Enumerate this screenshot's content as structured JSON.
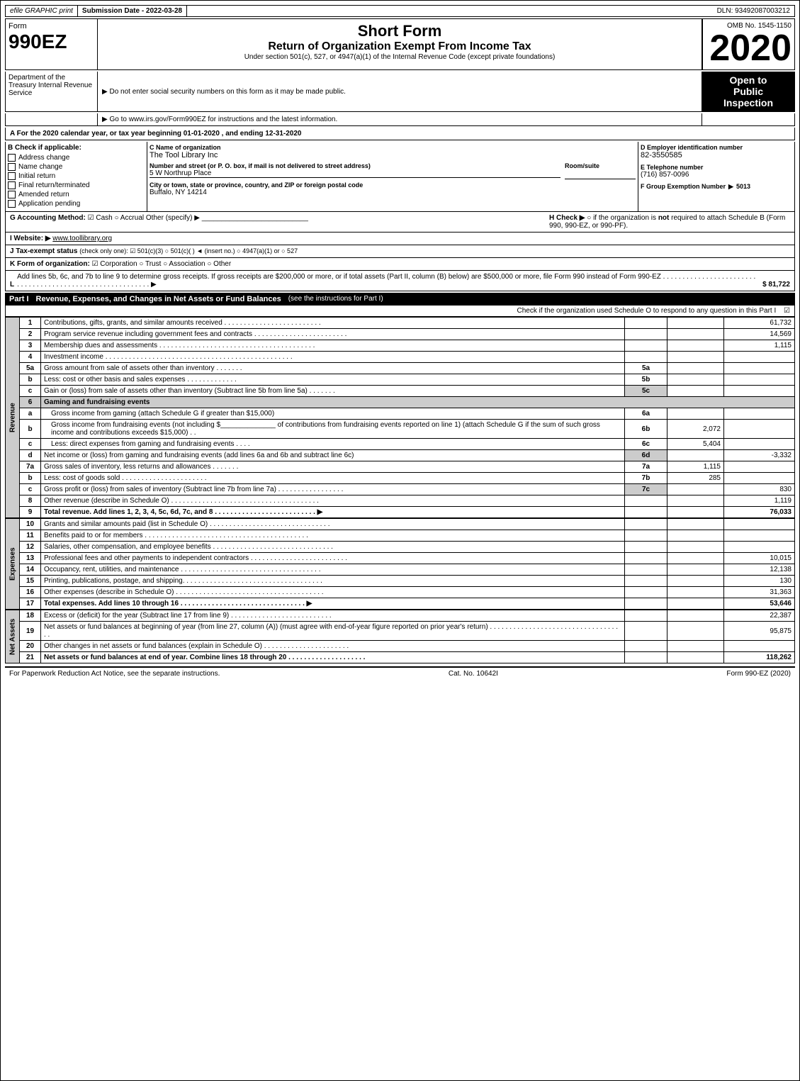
{
  "header": {
    "efile_label": "efile GRAPHIC print",
    "submission_date_label": "Submission Date - 2022-03-28",
    "dln_label": "DLN: 93492087003212",
    "form_number": "Form",
    "form_990ez": "990EZ",
    "form_title": "Short Form",
    "form_subtitle": "Return of Organization Exempt From Income Tax",
    "form_under": "Under section 501(c), 527, or 4947(a)(1) of the Internal Revenue Code (except private foundations)",
    "omb_label": "OMB No. 1545-1150",
    "year": "2020",
    "dept_name": "Department of the Treasury Internal Revenue Service",
    "notice1": "▶ Do not enter social security numbers on this form as it may be made public.",
    "notice2": "▶ Go to www.irs.gov/Form990EZ for instructions and the latest information.",
    "open_label1": "Open to",
    "open_label2": "Public",
    "open_label3": "Inspection"
  },
  "tax_year": {
    "text": "A For the 2020 calendar year, or tax year beginning 01-01-2020 , and ending 12-31-2020"
  },
  "section_b": {
    "label": "B Check if applicable:",
    "items": [
      {
        "label": "Address change",
        "checked": false
      },
      {
        "label": "Name change",
        "checked": false
      },
      {
        "label": "Initial return",
        "checked": false
      },
      {
        "label": "Final return/terminated",
        "checked": false
      },
      {
        "label": "Amended return",
        "checked": false
      },
      {
        "label": "Application pending",
        "checked": false
      }
    ]
  },
  "section_c": {
    "label": "C Name of organization",
    "org_name": "The Tool Library Inc",
    "address_label": "Number and street (or P. O. box, if mail is not delivered to street address)",
    "address": "5 W Northrup Place",
    "room_suite_label": "Room/suite",
    "room_suite": "",
    "city_label": "City or town, state or province, country, and ZIP or foreign postal code",
    "city": "Buffalo, NY  14214"
  },
  "section_d": {
    "label": "D Employer identification number",
    "ein": "82-3550585"
  },
  "section_e": {
    "label": "E Telephone number",
    "phone": "(716) 857-0096"
  },
  "section_f": {
    "label": "F Group Exemption Number",
    "number_label": "Number",
    "arrow": "▶",
    "number": "5013"
  },
  "section_g": {
    "label": "G Accounting Method:",
    "cash": "☑ Cash",
    "accrual": "○ Accrual",
    "other": "Other (specify) ▶"
  },
  "section_h": {
    "label": "H Check ▶",
    "text": "○ if the organization is not required to attach Schedule B (Form 990, 990-EZ, or 990-PF)."
  },
  "section_i": {
    "label": "I Website: ▶",
    "url": "www.toollibrary.org"
  },
  "section_j": {
    "label": "J Tax-exempt status",
    "text": "(check only one): ☑ 501(c)(3) ○ 501(c)( ) ◄ (insert no.) ○ 4947(a)(1) or ○ 527"
  },
  "section_k": {
    "label": "K Form of organization:",
    "items": [
      "☑ Corporation",
      "○ Trust",
      "○ Association",
      "○ Other"
    ]
  },
  "section_l": {
    "label": "L",
    "text": "Add lines 5b, 6c, and 7b to line 9 to determine gross receipts. If gross receipts are $200,000 or more, or if total assets (Part II, column (B) below) are $500,000 or more, file Form 990 instead of Form 990-EZ",
    "dots": ". . . . . . . . . . . . . . . . . . . . . . . . . . . . . . . . . . . . . . . . . . . . . . . . . . . . . . . . . . ▶",
    "amount": "$ 81,722"
  },
  "part1": {
    "label": "Part I",
    "title": "Revenue, Expenses, and Changes in Net Assets or Fund Balances",
    "see_instructions": "(see the instructions for Part I)",
    "schedule_o_text": "Check if the organization used Schedule O to respond to any question in this Part I",
    "rows": [
      {
        "num": "1",
        "desc": "Contributions, gifts, grants, and similar amounts received . . . . . . . . . . . . . . . . . . . . . . . . .",
        "col_num": "",
        "amount": "61,732",
        "shaded": false
      },
      {
        "num": "2",
        "desc": "Program service revenue including government fees and contracts . . . . . . . . . . . . . . . . . . . . . . . .",
        "col_num": "",
        "amount": "14,569",
        "shaded": false
      },
      {
        "num": "3",
        "desc": "Membership dues and assessments . . . . . . . . . . . . . . . . . . . . . . . . . . . . . . . . . . . . . . . .",
        "col_num": "",
        "amount": "1,115",
        "shaded": false
      },
      {
        "num": "4",
        "desc": "Investment income . . . . . . . . . . . . . . . . . . . . . . . . . . . . . . . . . . . . . . . . . . . . . . . .",
        "col_num": "",
        "amount": "",
        "shaded": false
      },
      {
        "num": "5a",
        "desc": "Gross amount from sale of assets other than inventory . . . . . . . .",
        "col_num": "5a",
        "amount": "",
        "shaded": false
      },
      {
        "num": "b",
        "desc": "Less: cost or other basis and sales expenses . . . . . . . . . . . . .",
        "col_num": "5b",
        "amount": "",
        "shaded": false
      },
      {
        "num": "c",
        "desc": "Gain or (loss) from sale of assets other than inventory (Subtract line 5b from line 5a) . . . . . . .",
        "col_num": "",
        "amount": "",
        "shaded": false,
        "right_col": "5c"
      },
      {
        "num": "6",
        "desc": "Gaming and fundraising events",
        "col_num": "",
        "amount": "",
        "shaded": true,
        "header": true
      },
      {
        "num": "a",
        "desc": "Gross income from gaming (attach Schedule G if greater than $15,000)",
        "col_num": "6a",
        "amount": "",
        "shaded": false,
        "indent": true
      },
      {
        "num": "b",
        "desc": "Gross income from fundraising events (not including $______________ of contributions from fundraising events reported on line 1) (attach Schedule G if the sum of such gross income and contributions exceeds $15,000) . .",
        "col_num": "6b",
        "col_val": "2,072",
        "amount": "",
        "shaded": false,
        "indent": true
      },
      {
        "num": "c",
        "desc": "Less: direct expenses from gaming and fundraising events . . . .",
        "col_num": "6c",
        "col_val": "5,404",
        "amount": "",
        "shaded": false,
        "indent": true
      },
      {
        "num": "d",
        "desc": "Net income or (loss) from gaming and fundraising events (add lines 6a and 6b and subtract line 6c)",
        "col_num": "",
        "amount": "-3,332",
        "shaded": false,
        "right_col": "6d"
      },
      {
        "num": "7a",
        "desc": "Gross sales of inventory, less returns and allowances . . . . . . .",
        "col_num": "7a",
        "col_val": "1,115",
        "amount": "",
        "shaded": false
      },
      {
        "num": "b",
        "desc": "Less: cost of goods sold . . . . . . . . . . . . . . . . . . . . . .",
        "col_num": "7b",
        "col_val": "285",
        "amount": "",
        "shaded": false
      },
      {
        "num": "c",
        "desc": "Gross profit or (loss) from sales of inventory (Subtract line 7b from line 7a) . . . . . . . . . . . . . . . .",
        "col_num": "",
        "amount": "830",
        "shaded": false,
        "right_col": "7c"
      },
      {
        "num": "8",
        "desc": "Other revenue (describe in Schedule O) . . . . . . . . . . . . . . . . . . . . . . . . . . . . . . . . . . . . . .",
        "col_num": "",
        "amount": "1,119",
        "shaded": false
      },
      {
        "num": "9",
        "desc": "Total revenue. Add lines 1, 2, 3, 4, 5c, 6d, 7c, and 8 . . . . . . . . . . . . . . . . . . . . . . . . . . ▶",
        "col_num": "",
        "amount": "76,033",
        "shaded": false,
        "bold": true
      }
    ]
  },
  "expenses": {
    "rows": [
      {
        "num": "10",
        "desc": "Grants and similar amounts paid (list in Schedule O) . . . . . . . . . . . . . . . . . . . . . . . . . . . . . . .",
        "amount": ""
      },
      {
        "num": "11",
        "desc": "Benefits paid to or for members . . . . . . . . . . . . . . . . . . . . . . . . . . . . . . . . . . . . . . . . . .",
        "amount": ""
      },
      {
        "num": "12",
        "desc": "Salaries, other compensation, and employee benefits . . . . . . . . . . . . . . . . . . . . . . . . . . . . . . .",
        "amount": ""
      },
      {
        "num": "13",
        "desc": "Professional fees and other payments to independent contractors . . . . . . . . . . . . . . . . . . . . . . . . .",
        "amount": "10,015"
      },
      {
        "num": "14",
        "desc": "Occupancy, rent, utilities, and maintenance . . . . . . . . . . . . . . . . . . . . . . . . . . . . . . . . . . . .",
        "amount": "12,138"
      },
      {
        "num": "15",
        "desc": "Printing, publications, postage, and shipping. . . . . . . . . . . . . . . . . . . . . . . . . . . . . . . . . . . .",
        "amount": "130"
      },
      {
        "num": "16",
        "desc": "Other expenses (describe in Schedule O) . . . . . . . . . . . . . . . . . . . . . . . . . . . . . . . . . . . . . .",
        "amount": "31,363"
      },
      {
        "num": "17",
        "desc": "Total expenses. Add lines 10 through 16 . . . . . . . . . . . . . . . . . . . . . . . . . . . . . . . . ▶",
        "amount": "53,646",
        "bold": true
      }
    ]
  },
  "net_assets": {
    "rows": [
      {
        "num": "18",
        "desc": "Excess or (deficit) for the year (Subtract line 17 from line 9) . . . . . . . . . . . . . . . . . . . . . . . . . .",
        "amount": "22,387"
      },
      {
        "num": "19",
        "desc": "Net assets or fund balances at beginning of year (from line 27, column (A)) (must agree with end-of-year figure reported on prior year's return) . . . . . . . . . . . . . . . . . . . . . . . . . . . . . . . . . . .",
        "amount": "95,875"
      },
      {
        "num": "20",
        "desc": "Other changes in net assets or fund balances (explain in Schedule O) . . . . . . . . . . . . . . . . . . . . . .",
        "amount": ""
      },
      {
        "num": "21",
        "desc": "Net assets or fund balances at end of year. Combine lines 18 through 20 . . . . . . . . . . . . . . . . . . . .",
        "amount": "118,262",
        "bold": true
      }
    ]
  },
  "footer": {
    "paperwork_text": "For Paperwork Reduction Act Notice, see the separate instructions.",
    "cat_no": "Cat. No. 10642I",
    "form_label": "Form 990-EZ (2020)"
  }
}
